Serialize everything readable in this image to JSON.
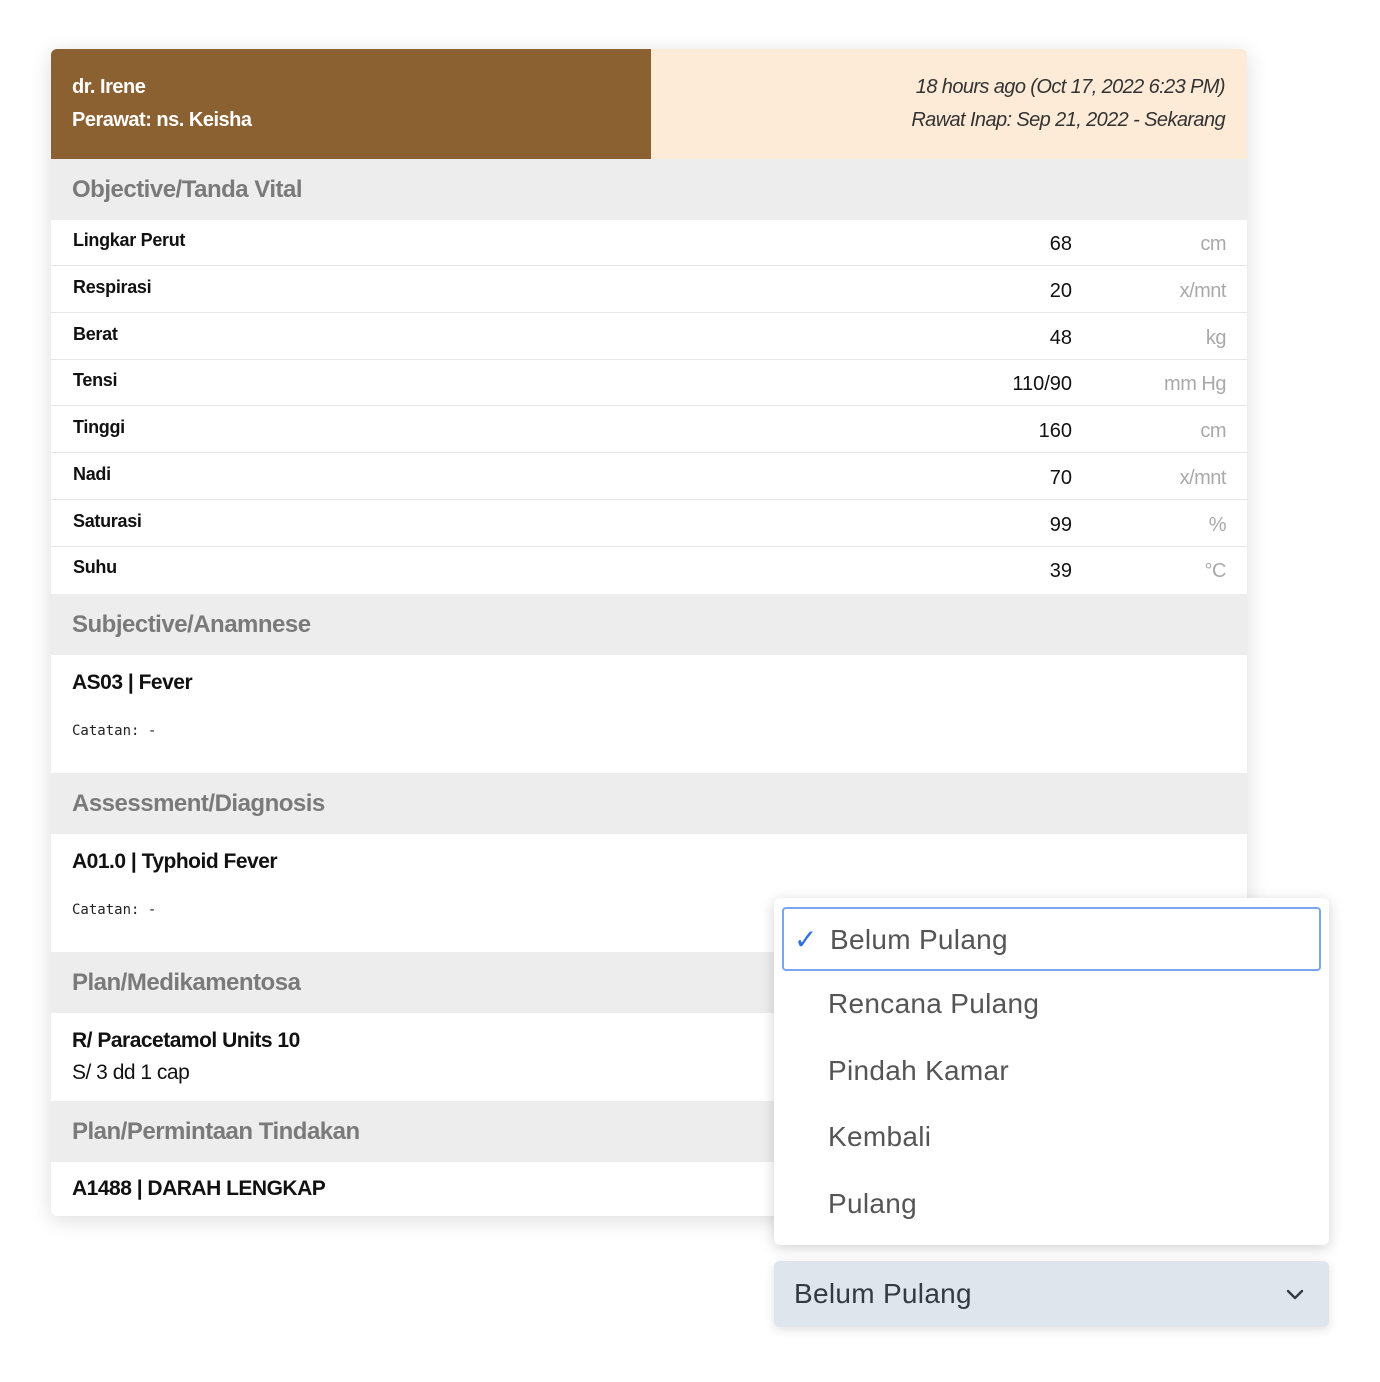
{
  "header": {
    "doctor": "dr. Irene",
    "nurse": "Perawat: ns. Keisha",
    "time_ago": "18 hours ago (Oct 17, 2022 6:23 PM)",
    "stay": "Rawat Inap: Sep 21, 2022 - Sekarang"
  },
  "objective": {
    "title": "Objective/Tanda Vital",
    "rows": [
      {
        "label": "Lingkar Perut",
        "value": "68",
        "unit": "cm"
      },
      {
        "label": "Respirasi",
        "value": "20",
        "unit": "x/mnt"
      },
      {
        "label": "Berat",
        "value": "48",
        "unit": "kg"
      },
      {
        "label": "Tensi",
        "value": "110/90",
        "unit": "mm Hg"
      },
      {
        "label": "Tinggi",
        "value": "160",
        "unit": "cm"
      },
      {
        "label": "Nadi",
        "value": "70",
        "unit": "x/mnt"
      },
      {
        "label": "Saturasi",
        "value": "99",
        "unit": "%"
      },
      {
        "label": "Suhu",
        "value": "39",
        "unit": "°C"
      }
    ]
  },
  "subjective": {
    "title": "Subjective/Anamnese",
    "entry": "AS03 | Fever",
    "note": "Catatan: -"
  },
  "assessment": {
    "title": "Assessment/Diagnosis",
    "entry": "A01.0 | Typhoid Fever",
    "note": "Catatan: -"
  },
  "plan_med": {
    "title": "Plan/Medikamentosa",
    "entry": "R/ Paracetamol Units 10",
    "signa": "S/ 3 dd 1 cap"
  },
  "plan_action": {
    "title": "Plan/Permintaan Tindakan",
    "entry": "A1488 | DARAH LENGKAP"
  },
  "status_dropdown": {
    "options": [
      "Belum Pulang",
      "Rencana Pulang",
      "Pindah Kamar",
      "Kembali",
      "Pulang"
    ],
    "selected": "Belum Pulang",
    "check_color": "#2f6fe0"
  },
  "colors": {
    "header_left": "#8b6131",
    "header_right": "#fdebd8",
    "section_bg": "#ededed"
  }
}
